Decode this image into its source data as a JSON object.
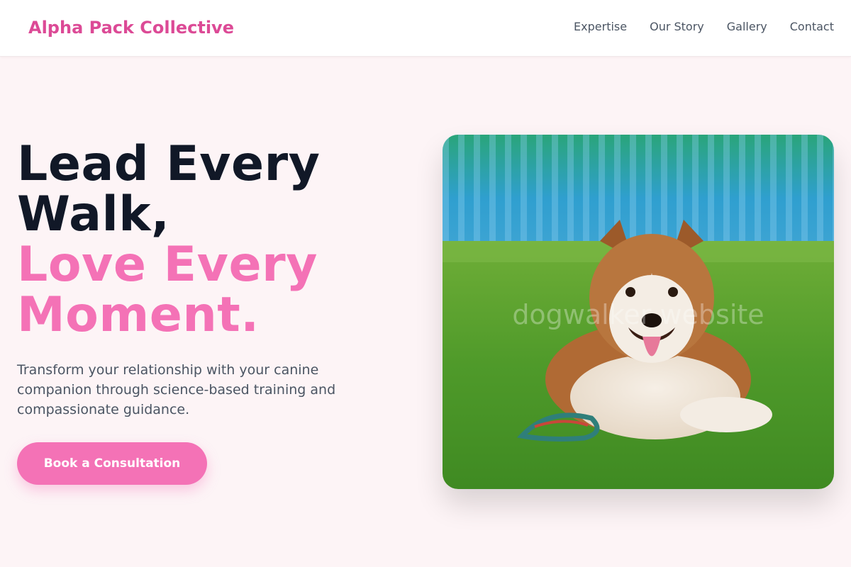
{
  "header": {
    "brand": "Alpha Pack Collective",
    "nav": [
      {
        "label": "Expertise"
      },
      {
        "label": "Our Story"
      },
      {
        "label": "Gallery"
      },
      {
        "label": "Contact"
      }
    ]
  },
  "hero": {
    "headline_line1": "Lead Every",
    "headline_line2": "Walk,",
    "headline_line3": "Love Every",
    "headline_line4": "Moment.",
    "subtitle": "Transform your relationship with your canine companion through science-based training and compassionate guidance.",
    "cta_label": "Book a Consultation"
  },
  "image": {
    "subject": "dog-lying-on-grass",
    "watermark": "dogwalker website"
  },
  "colors": {
    "brand": "#dc4a96",
    "accent": "#f472b6",
    "dark_text": "#111827",
    "body_text": "#4b5563",
    "background": "#fdf4f6"
  }
}
